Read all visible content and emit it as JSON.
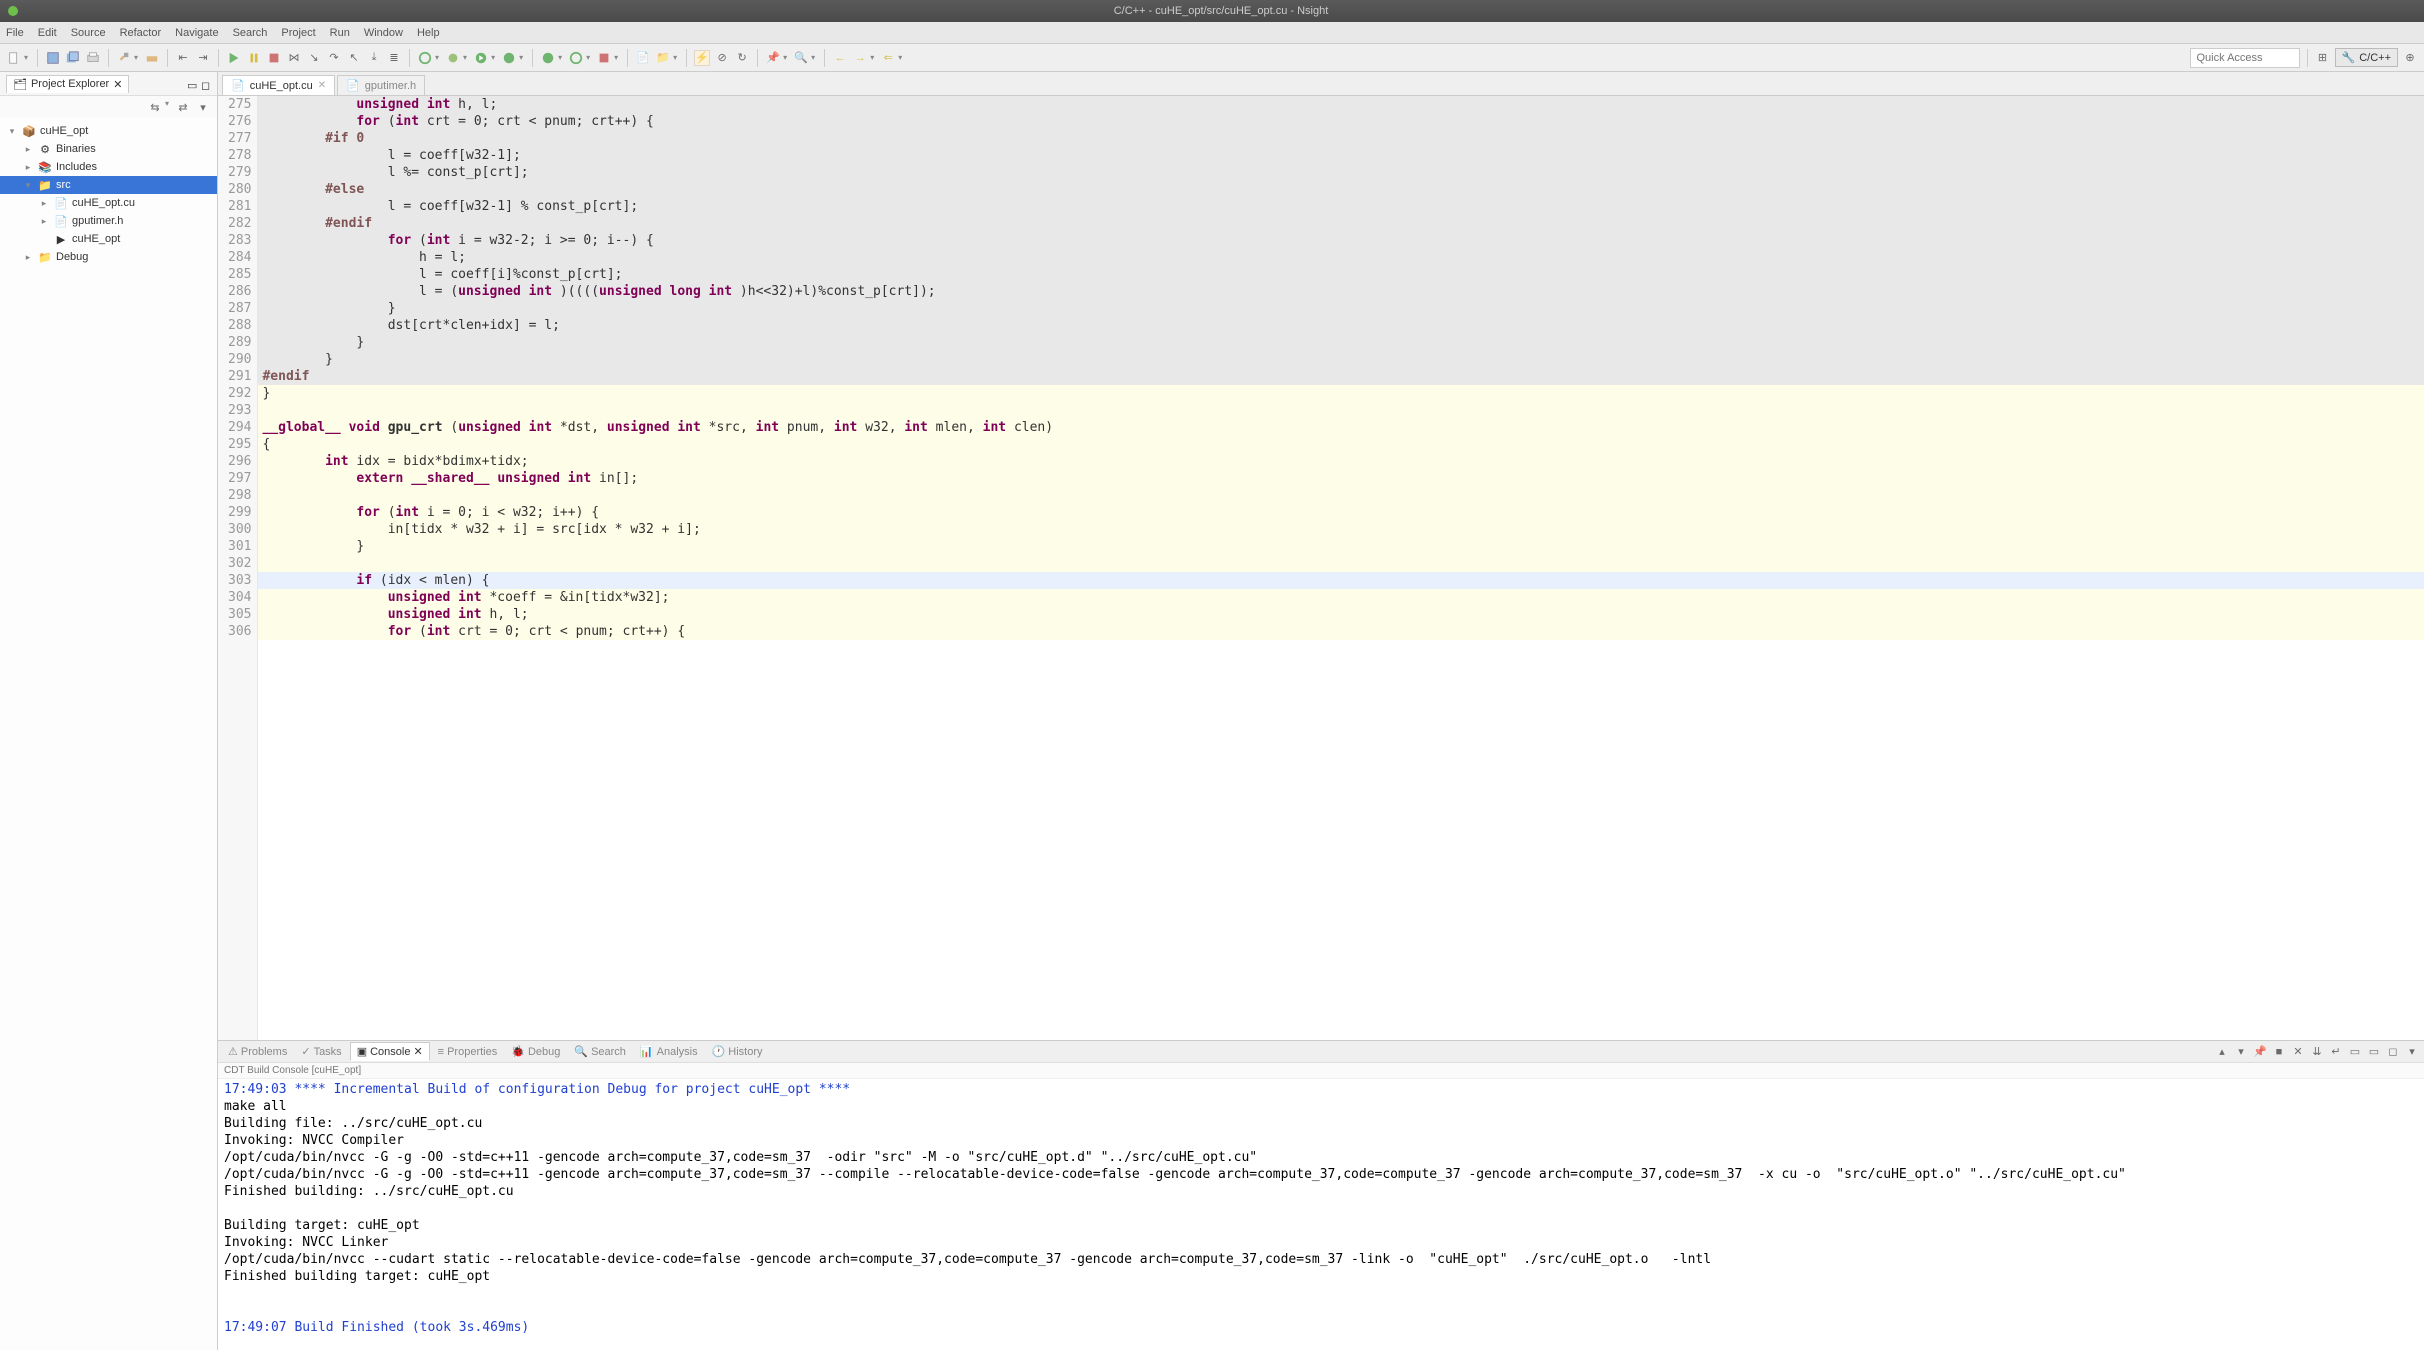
{
  "window": {
    "title": "C/C++ - cuHE_opt/src/cuHE_opt.cu - Nsight"
  },
  "menus": [
    "File",
    "Edit",
    "Source",
    "Refactor",
    "Navigate",
    "Search",
    "Project",
    "Run",
    "Window",
    "Help"
  ],
  "quick_access": {
    "placeholder": "Quick Access"
  },
  "perspective": {
    "label": "C/C++"
  },
  "explorer": {
    "title": "Project Explorer",
    "items": [
      {
        "label": "cuHE_opt",
        "depth": 0,
        "tw": "▾",
        "icon": "proj"
      },
      {
        "label": "Binaries",
        "depth": 1,
        "tw": "▸",
        "icon": "bin"
      },
      {
        "label": "Includes",
        "depth": 1,
        "tw": "▸",
        "icon": "inc"
      },
      {
        "label": "src",
        "depth": 1,
        "tw": "▾",
        "icon": "fld",
        "sel": true
      },
      {
        "label": "cuHE_opt.cu",
        "depth": 2,
        "tw": "▸",
        "icon": "cu"
      },
      {
        "label": "gputimer.h",
        "depth": 2,
        "tw": "▸",
        "icon": "h"
      },
      {
        "label": "cuHE_opt",
        "depth": 2,
        "tw": "",
        "icon": "exe"
      },
      {
        "label": "Debug",
        "depth": 1,
        "tw": "▸",
        "icon": "fld"
      }
    ]
  },
  "editor": {
    "tabs": [
      {
        "label": "cuHE_opt.cu",
        "active": true
      },
      {
        "label": "gputimer.h",
        "active": false
      }
    ],
    "first_line": 275,
    "lines": [
      {
        "n": 275,
        "bg": "gray",
        "tokens": [
          [
            " ",
            "            "
          ],
          [
            "kw",
            "unsigned int"
          ],
          [
            "",
            " h, l;"
          ]
        ]
      },
      {
        "n": 276,
        "bg": "gray",
        "tokens": [
          [
            " ",
            "            "
          ],
          [
            "kw",
            "for"
          ],
          [
            "",
            " ("
          ],
          [
            "kw",
            "int"
          ],
          [
            "",
            " crt = 0; crt < pnum; crt++) {"
          ]
        ]
      },
      {
        "n": 277,
        "bg": "gray",
        "tokens": [
          [
            " ",
            "        "
          ],
          [
            "pp",
            "#if 0"
          ]
        ]
      },
      {
        "n": 278,
        "bg": "gray",
        "tokens": [
          [
            " ",
            "                l = coeff[w32-1];"
          ]
        ]
      },
      {
        "n": 279,
        "bg": "gray",
        "tokens": [
          [
            " ",
            "                l %= const_p[crt];"
          ]
        ]
      },
      {
        "n": 280,
        "bg": "gray",
        "tokens": [
          [
            " ",
            "        "
          ],
          [
            "pp",
            "#else"
          ]
        ]
      },
      {
        "n": 281,
        "bg": "gray",
        "tokens": [
          [
            " ",
            "                l = coeff[w32-1] % const_p[crt];"
          ]
        ]
      },
      {
        "n": 282,
        "bg": "gray",
        "tokens": [
          [
            " ",
            "        "
          ],
          [
            "pp",
            "#endif"
          ]
        ]
      },
      {
        "n": 283,
        "bg": "gray",
        "tokens": [
          [
            " ",
            "                "
          ],
          [
            "kw",
            "for"
          ],
          [
            "",
            " ("
          ],
          [
            "kw",
            "int"
          ],
          [
            "",
            " i = w32-2; i >= 0; i--) {"
          ]
        ]
      },
      {
        "n": 284,
        "bg": "gray",
        "tokens": [
          [
            " ",
            "                    h = l;"
          ]
        ]
      },
      {
        "n": 285,
        "bg": "gray",
        "tokens": [
          [
            " ",
            "                    l = coeff[i]%const_p[crt];"
          ]
        ]
      },
      {
        "n": 286,
        "bg": "gray",
        "tokens": [
          [
            " ",
            "                    l = ("
          ],
          [
            "kw",
            "unsigned int"
          ],
          [
            "",
            " )(((("
          ],
          [
            "kw",
            "unsigned long int"
          ],
          [
            "",
            " )h<<32)+l)%const_p[crt]);"
          ]
        ]
      },
      {
        "n": 287,
        "bg": "gray",
        "tokens": [
          [
            " ",
            "                }"
          ]
        ]
      },
      {
        "n": 288,
        "bg": "gray",
        "tokens": [
          [
            " ",
            "                dst[crt*clen+idx] = l;"
          ]
        ]
      },
      {
        "n": 289,
        "bg": "gray",
        "tokens": [
          [
            " ",
            "            }"
          ]
        ]
      },
      {
        "n": 290,
        "bg": "gray",
        "tokens": [
          [
            " ",
            "        }"
          ]
        ]
      },
      {
        "n": 291,
        "bg": "gray",
        "tokens": [
          [
            "pp",
            "#endif"
          ]
        ]
      },
      {
        "n": 292,
        "bg": "yel",
        "tokens": [
          [
            " ",
            "}"
          ]
        ]
      },
      {
        "n": 293,
        "bg": "yel",
        "tokens": [
          [
            " ",
            ""
          ]
        ]
      },
      {
        "n": 294,
        "bg": "yel",
        "tokens": [
          [
            "kw",
            "__global__"
          ],
          [
            "",
            " "
          ],
          [
            "kw",
            "void"
          ],
          [
            "",
            " "
          ],
          [
            "fn",
            "gpu_crt"
          ],
          [
            "",
            " ("
          ],
          [
            "kw",
            "unsigned int"
          ],
          [
            "",
            " *dst, "
          ],
          [
            "kw",
            "unsigned int"
          ],
          [
            "",
            " *src, "
          ],
          [
            "kw",
            "int"
          ],
          [
            "",
            " pnum, "
          ],
          [
            "kw",
            "int"
          ],
          [
            "",
            " w32, "
          ],
          [
            "kw",
            "int"
          ],
          [
            "",
            " mlen, "
          ],
          [
            "kw",
            "int"
          ],
          [
            "",
            " clen)"
          ]
        ]
      },
      {
        "n": 295,
        "bg": "yel",
        "tokens": [
          [
            " ",
            "{"
          ]
        ]
      },
      {
        "n": 296,
        "bg": "yel",
        "tokens": [
          [
            " ",
            "        "
          ],
          [
            "kw",
            "int"
          ],
          [
            "",
            " idx = bidx*bdimx+tidx;"
          ]
        ]
      },
      {
        "n": 297,
        "bg": "yel",
        "tokens": [
          [
            " ",
            "            "
          ],
          [
            "kw",
            "extern"
          ],
          [
            "",
            " "
          ],
          [
            "kw",
            "__shared__"
          ],
          [
            "",
            " "
          ],
          [
            "kw",
            "unsigned int"
          ],
          [
            "",
            " in[];"
          ]
        ]
      },
      {
        "n": 298,
        "bg": "yel",
        "tokens": [
          [
            " ",
            ""
          ]
        ]
      },
      {
        "n": 299,
        "bg": "yel",
        "tokens": [
          [
            " ",
            "            "
          ],
          [
            "kw",
            "for"
          ],
          [
            "",
            " ("
          ],
          [
            "kw",
            "int"
          ],
          [
            "",
            " i = 0; i < w32; i++) {"
          ]
        ]
      },
      {
        "n": 300,
        "bg": "yel",
        "tokens": [
          [
            " ",
            "                in[tidx * w32 + i] = src[idx * w32 + i];"
          ]
        ]
      },
      {
        "n": 301,
        "bg": "yel",
        "tokens": [
          [
            " ",
            "            }"
          ]
        ]
      },
      {
        "n": 302,
        "bg": "yel",
        "tokens": [
          [
            " ",
            ""
          ]
        ]
      },
      {
        "n": 303,
        "bg": "hl",
        "tokens": [
          [
            " ",
            "            "
          ],
          [
            "kw",
            "if"
          ],
          [
            "",
            " (idx < mlen) {"
          ]
        ]
      },
      {
        "n": 304,
        "bg": "yel",
        "tokens": [
          [
            " ",
            "                "
          ],
          [
            "kw",
            "unsigned int"
          ],
          [
            "",
            " *coeff = &in[tidx*w32];"
          ]
        ]
      },
      {
        "n": 305,
        "bg": "yel",
        "tokens": [
          [
            " ",
            "                "
          ],
          [
            "kw",
            "unsigned int"
          ],
          [
            "",
            " h, l;"
          ]
        ]
      },
      {
        "n": 306,
        "bg": "yel",
        "tokens": [
          [
            " ",
            "                "
          ],
          [
            "kw",
            "for"
          ],
          [
            "",
            " ("
          ],
          [
            "kw",
            "int"
          ],
          [
            "",
            " crt = 0; crt < pnum; crt++) {"
          ]
        ]
      }
    ]
  },
  "bottom": {
    "tabs": [
      "Problems",
      "Tasks",
      "Console",
      "Properties",
      "Debug",
      "Search",
      "Analysis",
      "History"
    ],
    "active_tab": "Console",
    "subtitle": "CDT Build Console [cuHE_opt]",
    "lines": [
      {
        "cls": "blue",
        "t": "17:49:03 **** Incremental Build of configuration Debug for project cuHE_opt ****"
      },
      {
        "cls": "",
        "t": "make all "
      },
      {
        "cls": "",
        "t": "Building file: ../src/cuHE_opt.cu"
      },
      {
        "cls": "",
        "t": "Invoking: NVCC Compiler"
      },
      {
        "cls": "",
        "t": "/opt/cuda/bin/nvcc -G -g -O0 -std=c++11 -gencode arch=compute_37,code=sm_37  -odir \"src\" -M -o \"src/cuHE_opt.d\" \"../src/cuHE_opt.cu\""
      },
      {
        "cls": "",
        "t": "/opt/cuda/bin/nvcc -G -g -O0 -std=c++11 -gencode arch=compute_37,code=sm_37 --compile --relocatable-device-code=false -gencode arch=compute_37,code=compute_37 -gencode arch=compute_37,code=sm_37  -x cu -o  \"src/cuHE_opt.o\" \"../src/cuHE_opt.cu\""
      },
      {
        "cls": "",
        "t": "Finished building: ../src/cuHE_opt.cu"
      },
      {
        "cls": "",
        "t": " "
      },
      {
        "cls": "",
        "t": "Building target: cuHE_opt"
      },
      {
        "cls": "",
        "t": "Invoking: NVCC Linker"
      },
      {
        "cls": "",
        "t": "/opt/cuda/bin/nvcc --cudart static --relocatable-device-code=false -gencode arch=compute_37,code=compute_37 -gencode arch=compute_37,code=sm_37 -link -o  \"cuHE_opt\"  ./src/cuHE_opt.o   -lntl"
      },
      {
        "cls": "",
        "t": "Finished building target: cuHE_opt"
      },
      {
        "cls": "",
        "t": " "
      },
      {
        "cls": "",
        "t": " "
      },
      {
        "cls": "blue",
        "t": "17:49:07 Build Finished (took 3s.469ms)"
      }
    ]
  }
}
